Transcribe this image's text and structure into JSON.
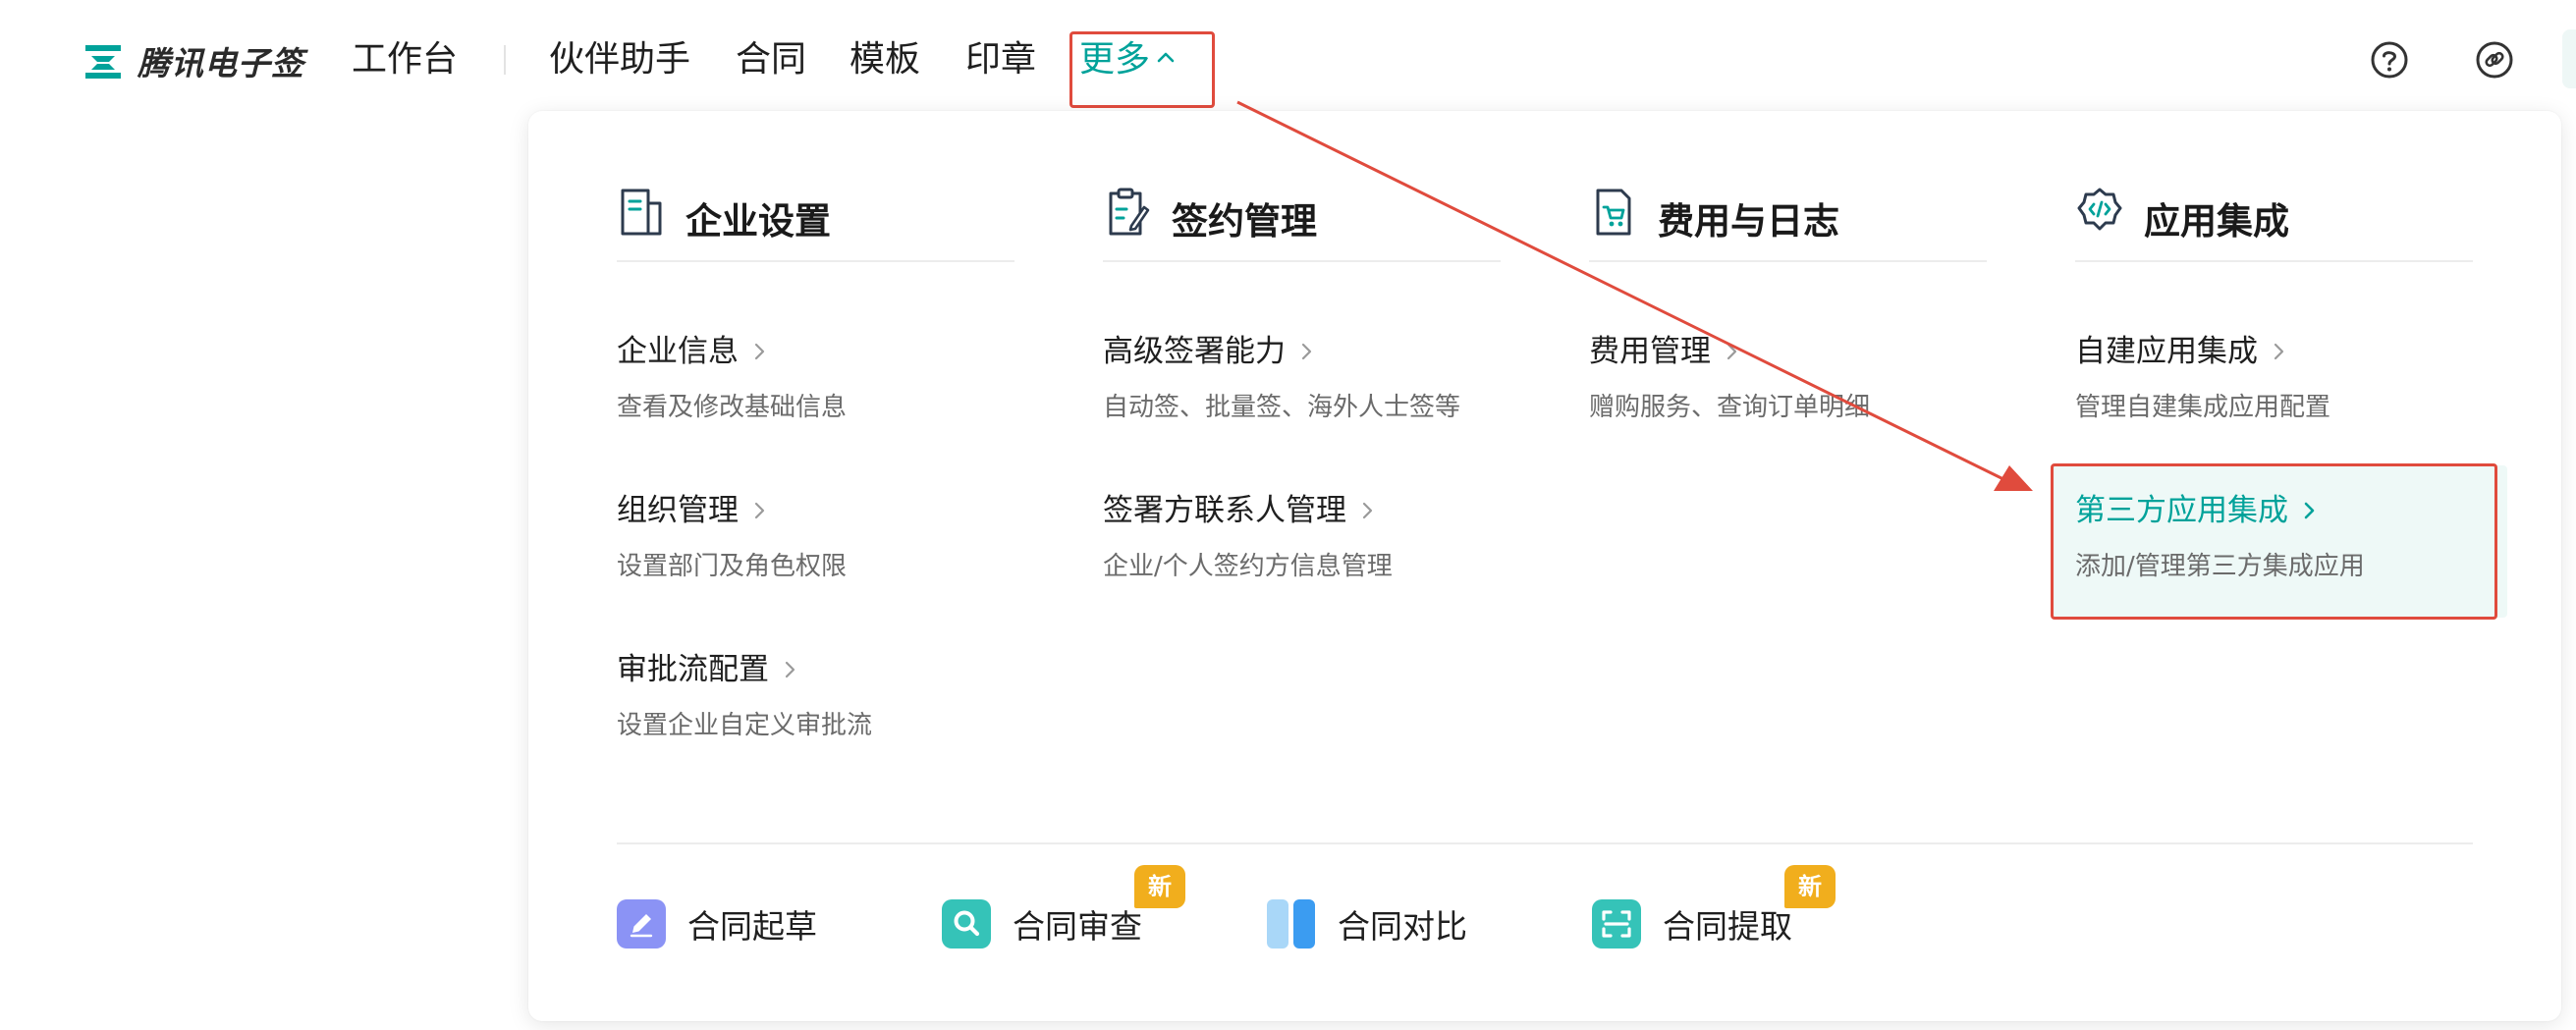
{
  "brand": {
    "name": "腾讯电子签"
  },
  "nav": {
    "items": [
      {
        "label": "工作台"
      },
      {
        "label": "伙伴助手"
      },
      {
        "label": "合同"
      },
      {
        "label": "模板"
      },
      {
        "label": "印章"
      },
      {
        "label": "更多"
      }
    ],
    "active_index": 5
  },
  "icons": {
    "help": "question-circle-icon",
    "link": "link-circle-icon"
  },
  "colors": {
    "accent": "#00a29a",
    "highlight_border": "#e04b3d",
    "badge": "#f1ae1d"
  },
  "menu": {
    "columns": [
      {
        "title": "企业设置",
        "icon": "document-icon",
        "items": [
          {
            "title": "企业信息",
            "desc": "查看及修改基础信息"
          },
          {
            "title": "组织管理",
            "desc": "设置部门及角色权限"
          },
          {
            "title": "审批流配置",
            "desc": "设置企业自定义审批流"
          }
        ]
      },
      {
        "title": "签约管理",
        "icon": "clipboard-icon",
        "items": [
          {
            "title": "高级签署能力",
            "desc": "自动签、批量签、海外人士签等"
          },
          {
            "title": "签署方联系人管理",
            "desc": "企业/个人签约方信息管理"
          }
        ]
      },
      {
        "title": "费用与日志",
        "icon": "cart-icon",
        "items": [
          {
            "title": "费用管理",
            "desc": "赠购服务、查询订单明细"
          }
        ]
      },
      {
        "title": "应用集成",
        "icon": "code-badge-icon",
        "items": [
          {
            "title": "自建应用集成",
            "desc": "管理自建集成应用配置"
          },
          {
            "title": "第三方应用集成",
            "desc": "添加/管理第三方集成应用",
            "active": true
          }
        ]
      }
    ],
    "tools": [
      {
        "label": "合同起草",
        "icon": "pen-icon",
        "badge": ""
      },
      {
        "label": "合同审查",
        "icon": "magnifier-icon",
        "badge": "新"
      },
      {
        "label": "合同对比",
        "icon": "compare-icon",
        "badge": ""
      },
      {
        "label": "合同提取",
        "icon": "scan-icon",
        "badge": "新"
      }
    ]
  }
}
